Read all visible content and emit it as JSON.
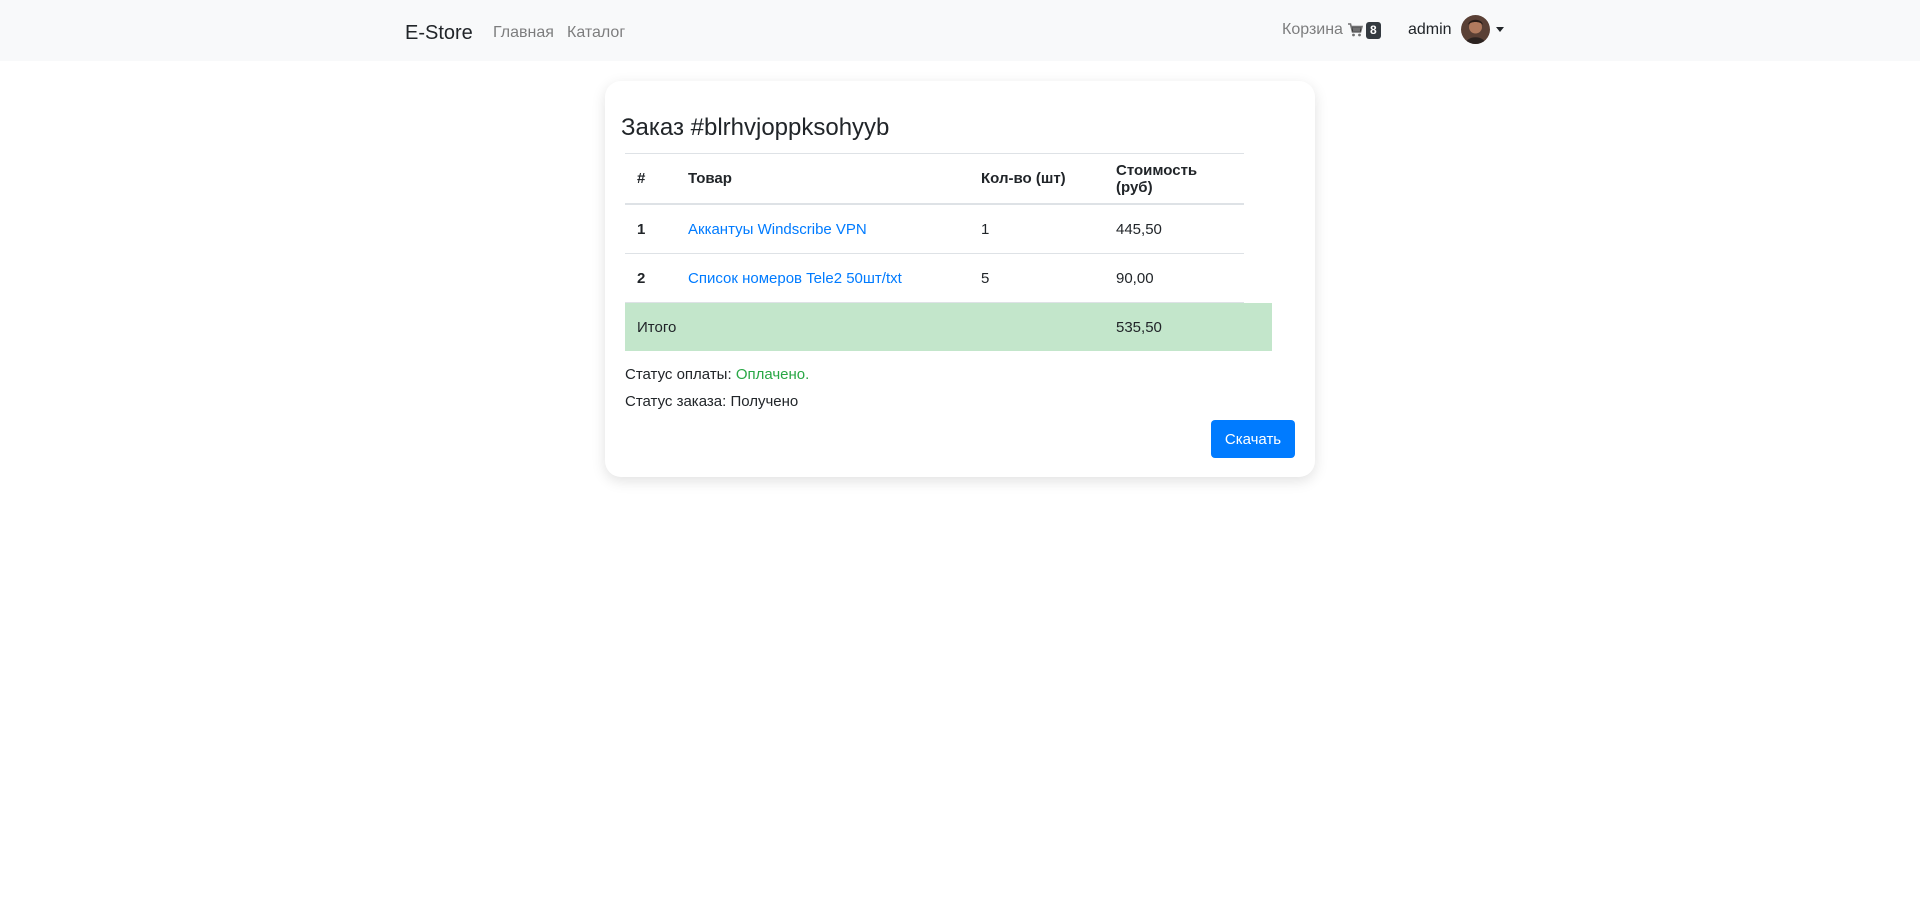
{
  "navbar": {
    "brand": "E-Store",
    "links": [
      "Главная",
      "Каталог"
    ],
    "cart_label": "Корзина",
    "cart_icon": "shopping-cart-icon",
    "cart_count": "8",
    "user_name": "admin"
  },
  "order": {
    "title": "Заказ #blrhvjoppksohyyb",
    "columns": [
      "#",
      "Товар",
      "Кол-во (шт)",
      "Стоимость (руб)"
    ],
    "items": [
      {
        "num": "1",
        "name": "Аккантуы Windscribe VPN",
        "qty": "1",
        "cost": "445,50"
      },
      {
        "num": "2",
        "name": "Список номеров Tele2 50шт/txt",
        "qty": "5",
        "cost": "90,00"
      }
    ],
    "total_label": "Итого",
    "total_value": "535,50",
    "payment_status_label": "Статус оплаты: ",
    "payment_status_value": "Оплачено.",
    "order_status_label": "Статус заказа: ",
    "order_status_value": "Получено",
    "download_label": "Скачать"
  },
  "colors": {
    "primary": "#007bff",
    "success_text": "#28a745",
    "total_row": "#c3e6cb",
    "navbar_bg": "#f8f9fa"
  }
}
